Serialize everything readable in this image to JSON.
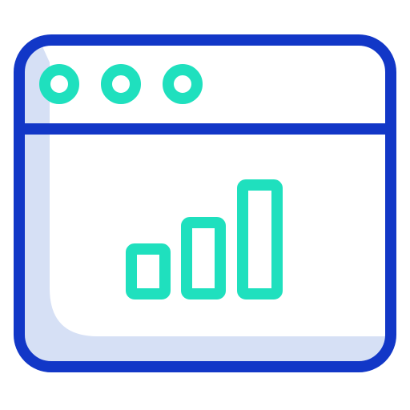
{
  "icon": {
    "name": "browser-window-analytics-icon",
    "colors": {
      "frame": "#1237C7",
      "accent": "#1FE0BE",
      "fill": "#D6E0F5",
      "background": "#FFFFFF"
    },
    "window_controls": [
      "dot-icon",
      "dot-icon",
      "dot-icon"
    ],
    "chart": {
      "bars": [
        1,
        2,
        3
      ]
    }
  }
}
